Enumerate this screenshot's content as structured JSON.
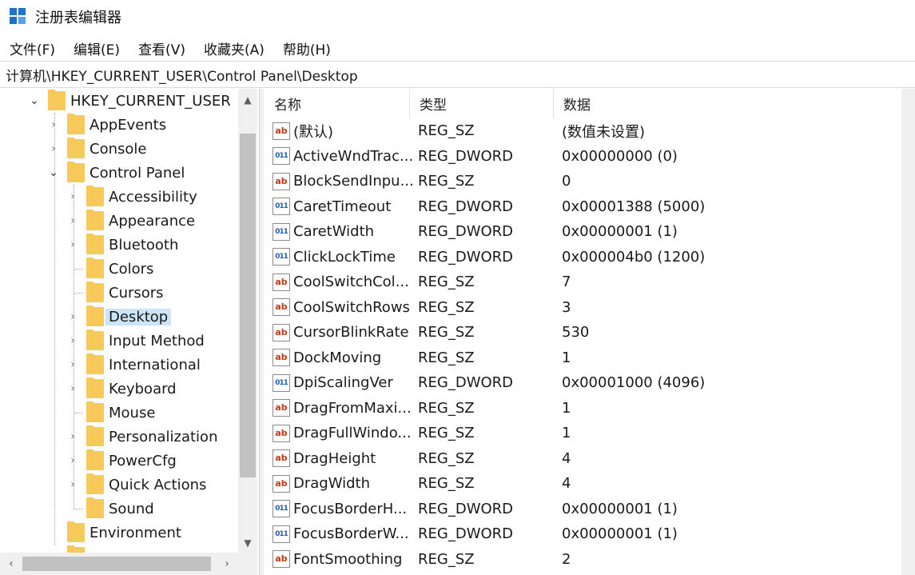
{
  "window": {
    "title": "注册表编辑器"
  },
  "menu": [
    "文件(F)",
    "编辑(E)",
    "查看(V)",
    "收藏夹(A)",
    "帮助(H)"
  ],
  "address": "计算机\\HKEY_CURRENT_USER\\Control Panel\\Desktop",
  "tree": {
    "root": "HKEY_CURRENT_USER",
    "items": [
      {
        "label": "AppEvents"
      },
      {
        "label": "Console"
      },
      {
        "label": "Control Panel"
      },
      {
        "label": "Accessibility"
      },
      {
        "label": "Appearance"
      },
      {
        "label": "Bluetooth"
      },
      {
        "label": "Colors"
      },
      {
        "label": "Cursors"
      },
      {
        "label": "Desktop"
      },
      {
        "label": "Input Method"
      },
      {
        "label": "International"
      },
      {
        "label": "Keyboard"
      },
      {
        "label": "Mouse"
      },
      {
        "label": "Personalization"
      },
      {
        "label": "PowerCfg"
      },
      {
        "label": "Quick Actions"
      },
      {
        "label": "Sound"
      },
      {
        "label": "Environment"
      }
    ]
  },
  "columns": {
    "name": "名称",
    "type": "类型",
    "data": "数据"
  },
  "values": [
    {
      "icon": "string-value-icon",
      "name": "(默认)",
      "type": "REG_SZ",
      "data": "(数值未设置)"
    },
    {
      "icon": "dword-value-icon",
      "name": "ActiveWndTrac...",
      "type": "REG_DWORD",
      "data": "0x00000000 (0)"
    },
    {
      "icon": "string-value-icon",
      "name": "BlockSendInpu...",
      "type": "REG_SZ",
      "data": "0"
    },
    {
      "icon": "dword-value-icon",
      "name": "CaretTimeout",
      "type": "REG_DWORD",
      "data": "0x00001388 (5000)"
    },
    {
      "icon": "dword-value-icon",
      "name": "CaretWidth",
      "type": "REG_DWORD",
      "data": "0x00000001 (1)"
    },
    {
      "icon": "dword-value-icon",
      "name": "ClickLockTime",
      "type": "REG_DWORD",
      "data": "0x000004b0 (1200)"
    },
    {
      "icon": "string-value-icon",
      "name": "CoolSwitchCol...",
      "type": "REG_SZ",
      "data": "7"
    },
    {
      "icon": "string-value-icon",
      "name": "CoolSwitchRows",
      "type": "REG_SZ",
      "data": "3"
    },
    {
      "icon": "string-value-icon",
      "name": "CursorBlinkRate",
      "type": "REG_SZ",
      "data": "530"
    },
    {
      "icon": "string-value-icon",
      "name": "DockMoving",
      "type": "REG_SZ",
      "data": "1"
    },
    {
      "icon": "dword-value-icon",
      "name": "DpiScalingVer",
      "type": "REG_DWORD",
      "data": "0x00001000 (4096)"
    },
    {
      "icon": "string-value-icon",
      "name": "DragFromMaxi...",
      "type": "REG_SZ",
      "data": "1"
    },
    {
      "icon": "string-value-icon",
      "name": "DragFullWindo...",
      "type": "REG_SZ",
      "data": "1"
    },
    {
      "icon": "string-value-icon",
      "name": "DragHeight",
      "type": "REG_SZ",
      "data": "4"
    },
    {
      "icon": "string-value-icon",
      "name": "DragWidth",
      "type": "REG_SZ",
      "data": "4"
    },
    {
      "icon": "dword-value-icon",
      "name": "FocusBorderH...",
      "type": "REG_DWORD",
      "data": "0x00000001 (1)"
    },
    {
      "icon": "dword-value-icon",
      "name": "FocusBorderW...",
      "type": "REG_DWORD",
      "data": "0x00000001 (1)"
    },
    {
      "icon": "string-value-icon",
      "name": "FontSmoothing",
      "type": "REG_SZ",
      "data": "2"
    }
  ],
  "icon_glyphs": {
    "string": "ab",
    "dword": "011"
  },
  "colors": {
    "folder": "#f7c958",
    "selection": "#cce4f7",
    "accent": "#1e73c8"
  }
}
